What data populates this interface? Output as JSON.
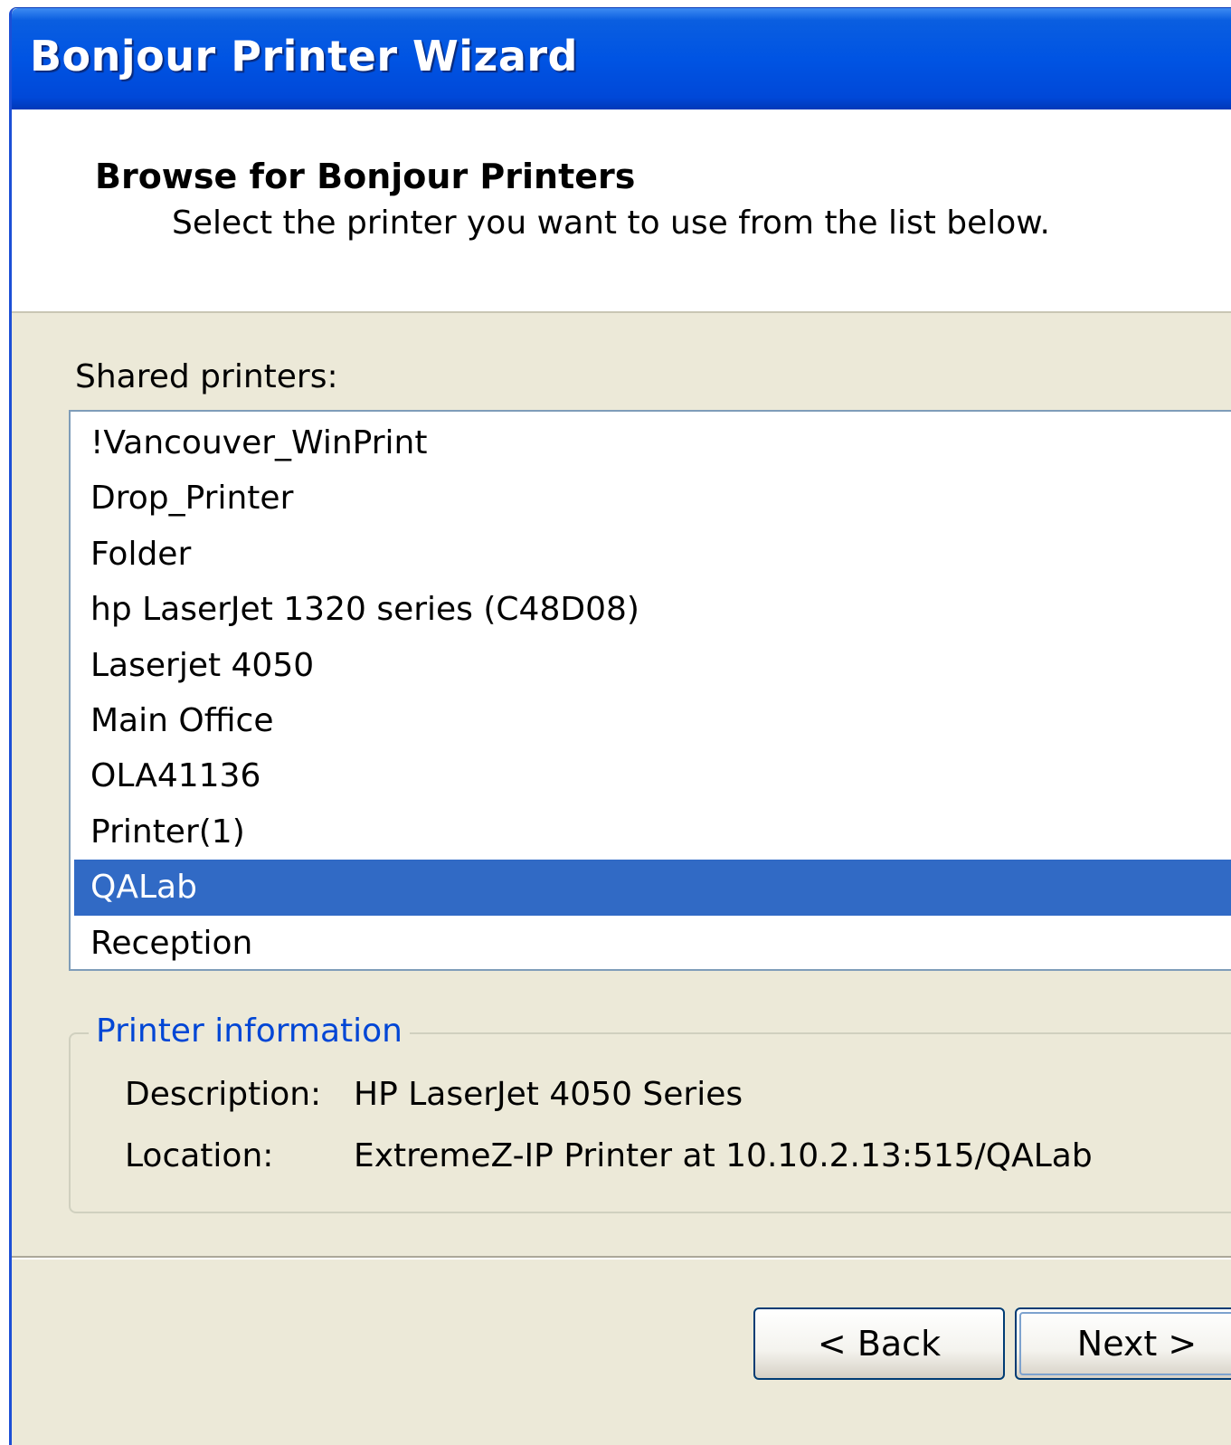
{
  "window": {
    "title": "Bonjour Printer Wizard"
  },
  "header": {
    "title": "Browse for Bonjour Printers",
    "subtitle": "Select the printer you want to use from the list below."
  },
  "printers": {
    "label": "Shared printers:",
    "items": [
      "!Vancouver_WinPrint",
      "Drop_Printer",
      "Folder",
      "hp LaserJet 1320 series (C48D08)",
      "Laserjet 4050",
      "Main Office",
      "OLA41136",
      "Printer(1)",
      "QALab",
      "Reception"
    ],
    "selected": "QALab"
  },
  "printer_info": {
    "legend": "Printer information",
    "description_label": "Description:",
    "description_value": "HP LaserJet 4050 Series",
    "location_label": "Location:",
    "location_value": "ExtremeZ-IP Printer at 10.10.2.13:515/QALab"
  },
  "buttons": {
    "back": "< Back",
    "next": "Next >"
  },
  "colors": {
    "titlebar": "#0054e3",
    "selection": "#316ac5",
    "legend_text": "#0046d5",
    "dialog_background": "#ece9d8"
  }
}
